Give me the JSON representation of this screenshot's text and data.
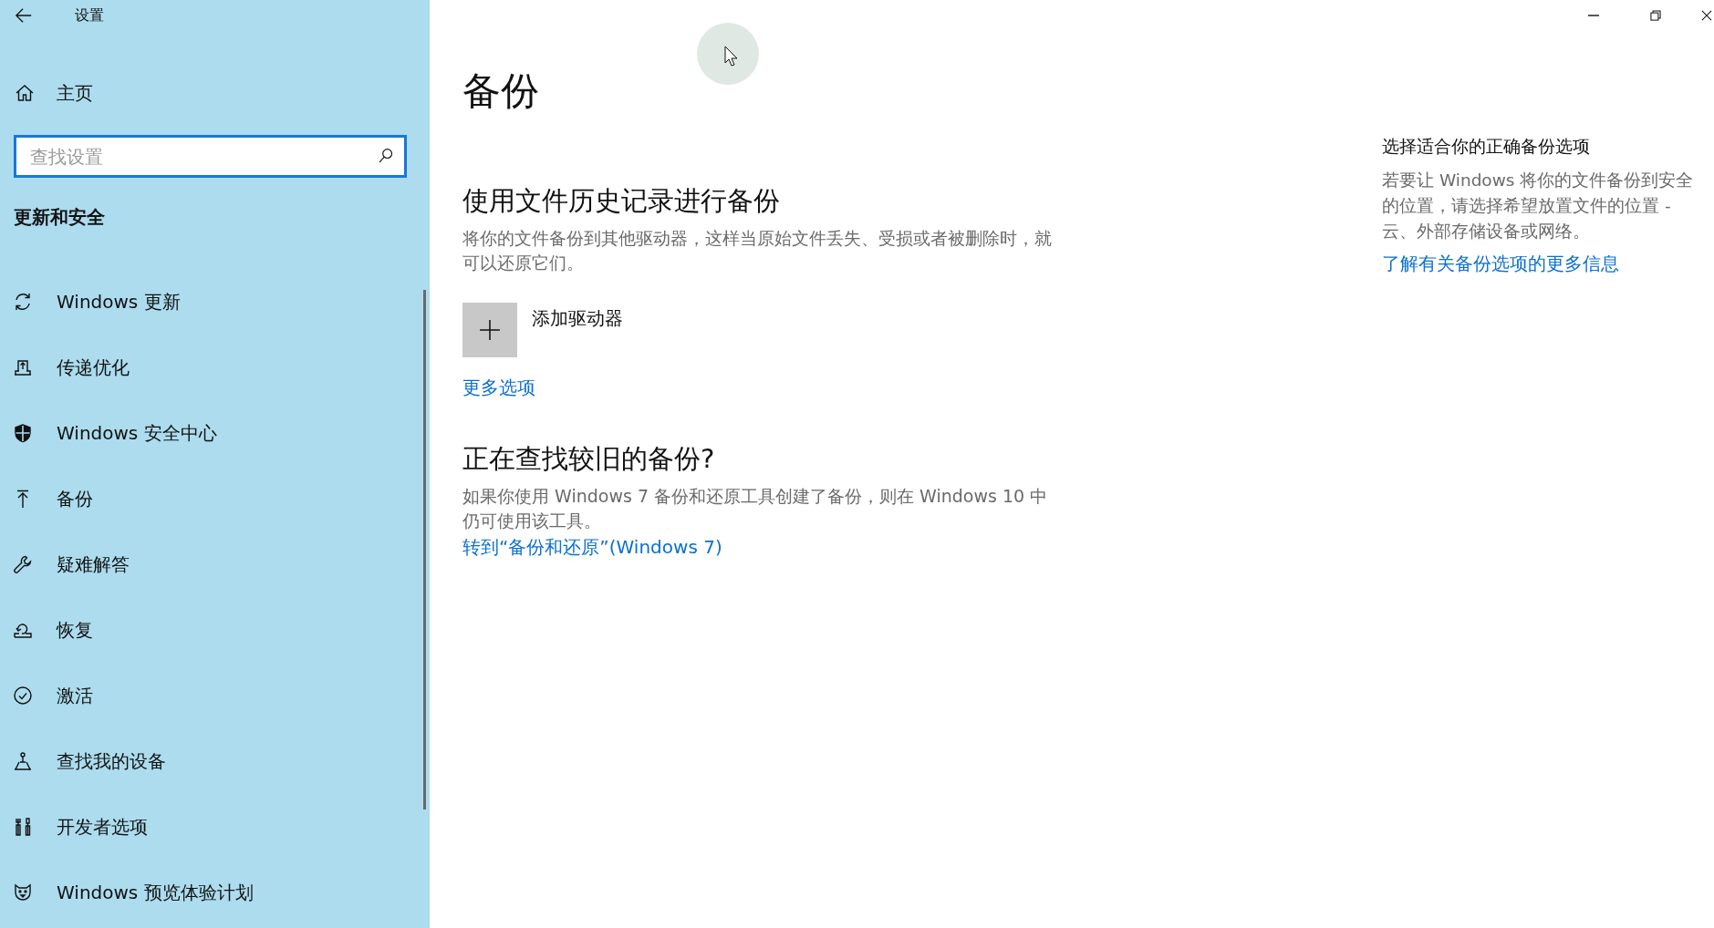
{
  "window": {
    "title": "设置"
  },
  "sidebar": {
    "home": "主页",
    "search": {
      "placeholder": "查找设置",
      "focused": true
    },
    "section": "更新和安全",
    "items": [
      {
        "label": "Windows 更新"
      },
      {
        "label": "传递优化"
      },
      {
        "label": "Windows 安全中心"
      },
      {
        "label": "备份"
      },
      {
        "label": "疑难解答"
      },
      {
        "label": "恢复"
      },
      {
        "label": "激活"
      },
      {
        "label": "查找我的设备"
      },
      {
        "label": "开发者选项"
      },
      {
        "label": "Windows 预览体验计划"
      }
    ]
  },
  "page": {
    "title": "备份",
    "sections": [
      {
        "heading": "使用文件历史记录进行备份",
        "description": "将你的文件备份到其他驱动器，这样当原始文件丢失、受损或者被删除时，就可以还原它们。",
        "add_drive": "添加驱动器",
        "link": "更多选项"
      },
      {
        "heading": "正在查找较旧的备份?",
        "description": "如果你使用 Windows 7 备份和还原工具创建了备份，则在 Windows 10 中仍可使用该工具。",
        "link": "转到“备份和还原”(Windows 7)"
      }
    ]
  },
  "aside": {
    "heading": "选择适合你的正确备份选项",
    "description": "若要让 Windows 将你的文件备份到安全的位置，请选择希望放置文件的位置 - 云、外部存储设备或网络。",
    "link": "了解有关备份选项的更多信息"
  }
}
